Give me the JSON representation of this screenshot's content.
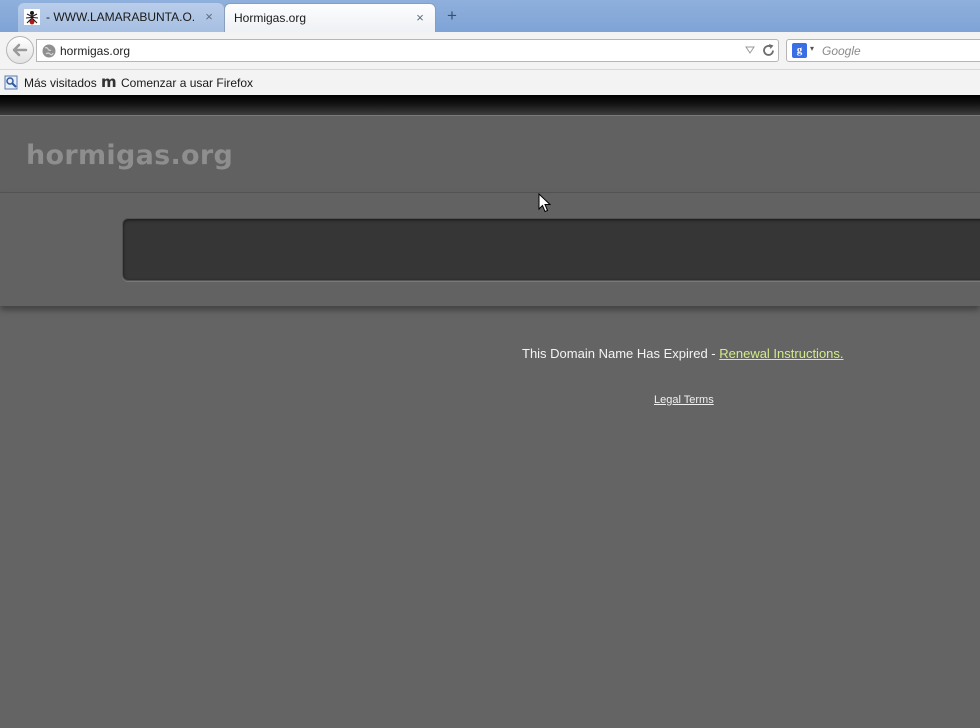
{
  "browser": {
    "tabs": [
      {
        "label": "- WWW.LAMARABUNTA.O...",
        "active": false,
        "favicon": "ant-favicon-icon"
      },
      {
        "label": "Hormigas.org",
        "active": true
      }
    ],
    "new_tab_symbol": "+",
    "close_symbol": "×",
    "url": "hormigas.org",
    "search_engine_letter": "g",
    "search_placeholder": "Google",
    "bookmarks": [
      {
        "label": "Más visitados",
        "icon": "most-visited-icon"
      },
      {
        "label": "Comenzar a usar Firefox",
        "icon": "m",
        "icon_name": "getting-started-icon"
      }
    ]
  },
  "page": {
    "site_name": "hormigas.org",
    "expired_message": "This Domain Name Has Expired - ",
    "renewal_link": "Renewal Instructions.",
    "legal_link": "Legal Terms"
  },
  "colors": {
    "page_background": "#646464",
    "renewal_link": "#d2ec8a",
    "logo_text": "#8e8e8e"
  }
}
